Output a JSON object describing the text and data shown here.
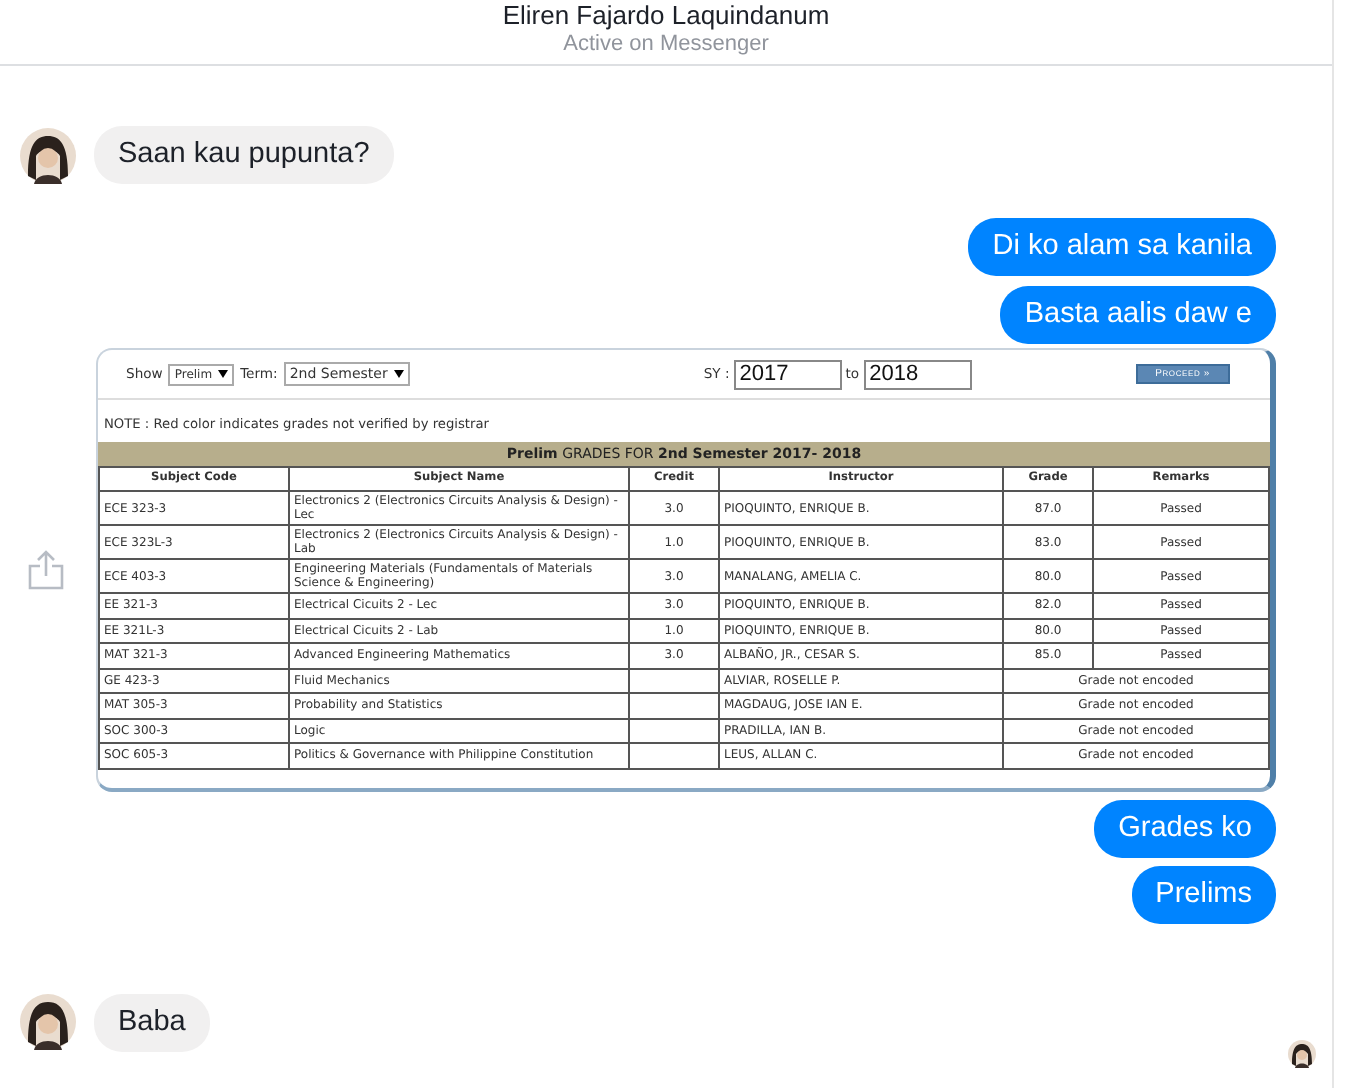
{
  "header": {
    "title": "Eliren Fajardo Laquindanum",
    "status": "Active on Messenger"
  },
  "messages": [
    {
      "kind": "received",
      "avatar": true,
      "text": "Saan kau pupunta?"
    },
    {
      "kind": "sent",
      "text": "Di ko alam sa kanila"
    },
    {
      "kind": "sent",
      "text": "Basta aalis daw e"
    },
    {
      "kind": "screenshot",
      "share": true,
      "toolbar": {
        "show_label": "Show",
        "show_value": "Prelim",
        "term_label": "Term:",
        "term_value": "2nd Semester",
        "sy_label": "SY :",
        "sy_from": "2017",
        "to_label": "to",
        "sy_to": "2018",
        "button": "Proceed »"
      },
      "note": "NOTE : Red color indicates grades not verified by registrar",
      "title": "**Prelim** GRADES FOR **2nd Semester 2017- 2018**",
      "columns": [
        "Subject Code",
        "Subject Name",
        "Credit",
        "Instructor",
        "Grade",
        "Remarks"
      ],
      "rows": [
        {
          "kind": "graded",
          "code": "ECE 323-3",
          "name": "Electronics 2 (Electronics Circuits Analysis & Design) - Lec",
          "credit": "3.0",
          "instructor": "PIOQUINTO, ENRIQUE B.",
          "grade": "87.0",
          "remarks": "Passed"
        },
        {
          "kind": "graded",
          "code": "ECE 323L-3",
          "name": "Electronics 2 (Electronics Circuits Analysis & Design) - Lab",
          "credit": "1.0",
          "instructor": "PIOQUINTO, ENRIQUE B.",
          "grade": "83.0",
          "remarks": "Passed"
        },
        {
          "kind": "graded",
          "code": "ECE 403-3",
          "name": "Engineering Materials (Fundamentals of Materials Science & Engineering)",
          "credit": "3.0",
          "instructor": "MANALANG, AMELIA C.",
          "grade": "80.0",
          "remarks": "Passed"
        },
        {
          "kind": "graded",
          "code": "EE 321-3",
          "name": "Electrical Cicuits 2 - Lec",
          "credit": "3.0",
          "instructor": "PIOQUINTO, ENRIQUE B.",
          "grade": "82.0",
          "remarks": "Passed"
        },
        {
          "kind": "graded",
          "code": "EE 321L-3",
          "name": "Electrical Cicuits 2 - Lab",
          "credit": "1.0",
          "instructor": "PIOQUINTO, ENRIQUE B.",
          "grade": "80.0",
          "remarks": "Passed"
        },
        {
          "kind": "graded",
          "code": "MAT 321-3",
          "name": "Advanced Engineering Mathematics",
          "credit": "3.0",
          "instructor": "ALBAÑO, JR., CESAR S.",
          "grade": "85.0",
          "remarks": "Passed"
        },
        {
          "kind": "not_encoded",
          "code": "GE 423-3",
          "name": "Fluid Mechanics",
          "instructor": "ALVIAR, ROSELLE P.",
          "remarks": "Grade not encoded"
        },
        {
          "kind": "not_encoded",
          "code": "MAT 305-3",
          "name": "Probability and Statistics",
          "instructor": "MAGDAUG, JOSE IAN E.",
          "remarks": "Grade not encoded"
        },
        {
          "kind": "not_encoded",
          "code": "SOC 300-3",
          "name": "Logic",
          "instructor": "PRADILLA, IAN B.",
          "remarks": "Grade not encoded"
        },
        {
          "kind": "not_encoded",
          "code": "SOC 605-3",
          "name": "Politics & Governance with Philippine Constitution",
          "instructor": "LEUS, ALLAN C.",
          "remarks": "Grade not encoded"
        }
      ]
    },
    {
      "kind": "sent",
      "text": "Grades ko"
    },
    {
      "kind": "sent",
      "text": "Prelims"
    },
    {
      "kind": "received",
      "avatar": true,
      "read_receipt": true,
      "text": "Baba"
    }
  ]
}
